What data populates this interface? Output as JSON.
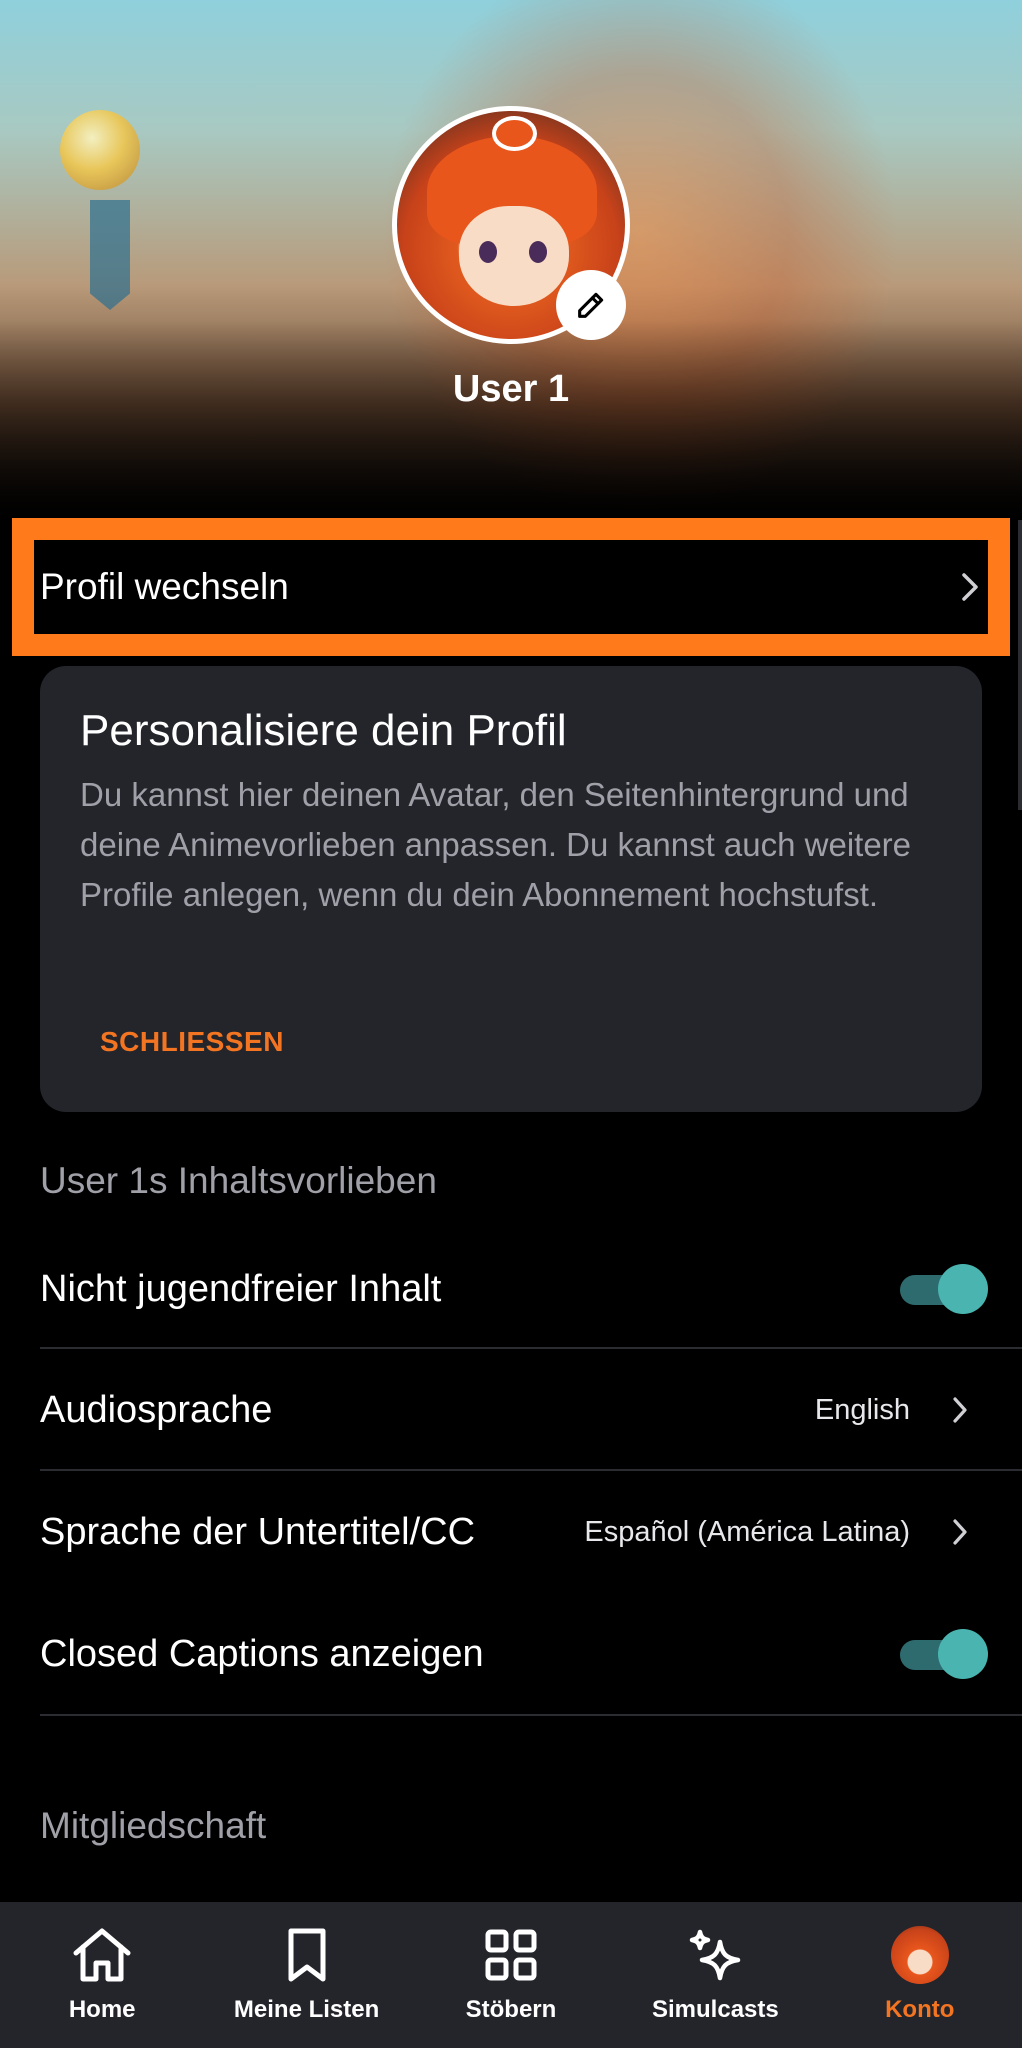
{
  "profile": {
    "username": "User 1",
    "switch_profile_label": "Profil wechseln"
  },
  "card": {
    "title": "Personalisiere dein Profil",
    "body": "Du kannst hier deinen Avatar, den Seitenhintergrund und deine Animevorlieben anpassen. Du kannst auch weitere Profile anlegen, wenn du dein Abonnement hochstufst.",
    "close_label": "SCHLIESSEN"
  },
  "preferences": {
    "section_title": "User 1s Inhaltsvorlieben",
    "mature_content_label": "Nicht jugendfreier Inhalt",
    "mature_content_enabled": true,
    "audio_language_label": "Audiosprache",
    "audio_language_value": "English",
    "subtitle_language_label": "Sprache der Untertitel/CC",
    "subtitle_language_value": "Español (América Latina)",
    "closed_captions_label": "Closed Captions anzeigen",
    "closed_captions_enabled": true
  },
  "membership": {
    "section_title": "Mitgliedschaft"
  },
  "nav": {
    "items": [
      {
        "label": "Home",
        "icon": "home-icon"
      },
      {
        "label": "Meine Listen",
        "icon": "bookmark-icon"
      },
      {
        "label": "Stöbern",
        "icon": "grid-icon"
      },
      {
        "label": "Simulcasts",
        "icon": "sparkle-icon"
      },
      {
        "label": "Konto",
        "icon": "profile-avatar-icon"
      }
    ],
    "active": "Konto"
  },
  "colors": {
    "accent": "#f47521",
    "highlight_outline": "#ff7a1a",
    "toggle_on": "#4ab5b0",
    "card_bg": "#23252b"
  }
}
